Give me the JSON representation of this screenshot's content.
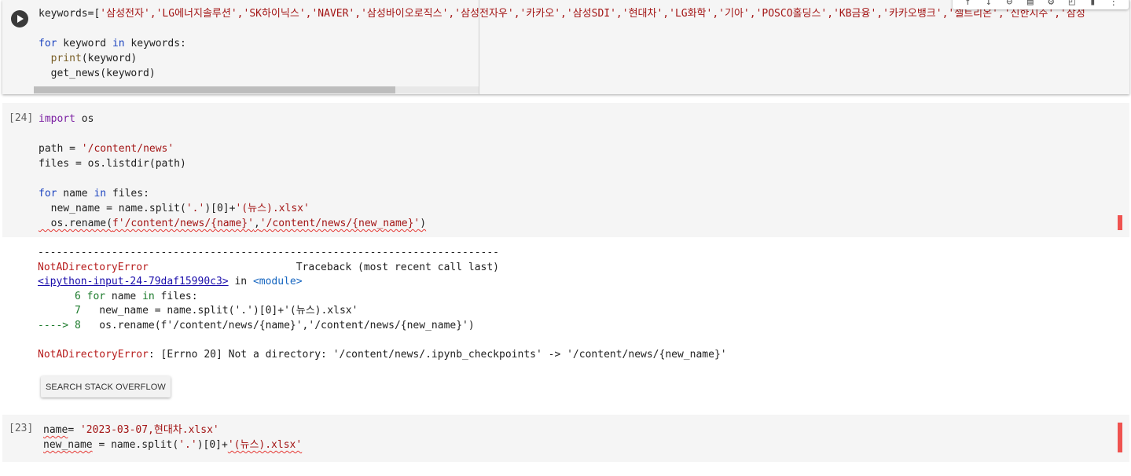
{
  "top_cell": {
    "run_button": "run-cell",
    "line1_prefix": "keywords=[",
    "line1_list": "'삼성전자','LG에너지솔루션','SK하이닉스','NAVER','삼성바이오로직스','삼성전자우','카카오','삼성SDI','현대차','LG화학','기아','POSCO홀딩스','KB금융','카카오뱅크','셀트리온','신한지주','삼성",
    "line3_for": "for",
    "line3_var": " keyword ",
    "line3_in": "in",
    "line3_rest": " keywords:",
    "line4_print": "print",
    "line4_rest": "(keyword)",
    "line5": "get_news(keyword)"
  },
  "toolbar": {
    "icons": [
      "arrow-up-icon",
      "arrow-down-icon",
      "link-icon",
      "comment-icon",
      "gear-icon",
      "mirror-cell-icon",
      "delete-icon",
      "more-vert-icon"
    ]
  },
  "cell_24": {
    "exec_count": "[24]",
    "l1_import": "import",
    "l1_rest": " os",
    "l3_a": "path = ",
    "l3_str": "'/content/news'",
    "l4": "files = os.listdir(path)",
    "l6_for": "for",
    "l6_a": " name ",
    "l6_in": "in",
    "l6_b": " files:",
    "l7_a": "  new_name = name.split(",
    "l7_s1": "'.'",
    "l7_b": ")[0]+",
    "l7_s2": "'(뉴스).xlsx'",
    "l8_a": "  os.rename(",
    "l8_s1": "f'/content/news/{name}'",
    "l8_comma": ",",
    "l8_s2": "'/content/news/{new_name}'",
    "l8_b": ")"
  },
  "output_24": {
    "dashes": "---------------------------------------------------------------------------",
    "err_name": "NotADirectoryError",
    "traceback_label": "                        Traceback (most recent call last)",
    "input_link": "<ipython-input-24-79daf15990c3>",
    "in_text": " in ",
    "module_text": "<module>",
    "l6_num": "      6",
    "l6_for": " for",
    "l6_rest": " name ",
    "l6_in": "in",
    "l6_end": " files:",
    "l7_num": "      7",
    "l7_text": "   new_name = name.split('.')[0]+'(뉴스).xlsx'",
    "l8_arrow": "----> 8",
    "l8_text": "   os.rename(f'/content/news/{name}','/content/news/{new_name}')",
    "final_name": "NotADirectoryError",
    "final_msg": ": [Errno 20] Not a directory: '/content/news/.ipynb_checkpoints' -> '/content/news/{new_name}'",
    "so_button": "SEARCH STACK OVERFLOW"
  },
  "cell_23": {
    "exec_count": "[23]",
    "l1_a": "name",
    "l1_b": "= ",
    "l1_str": "'2023-03-07,현대차.xlsx'",
    "l2_a": "new_name",
    "l2_b": " = name.split(",
    "l2_s1": "'.'",
    "l2_c": ")[0]+",
    "l2_s2": "'(뉴스).xlsx'"
  }
}
